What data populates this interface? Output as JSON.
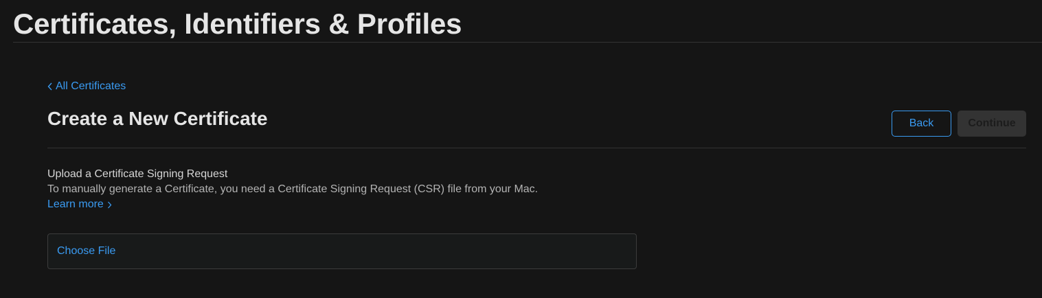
{
  "header": {
    "title": "Certificates, Identifiers & Profiles"
  },
  "nav": {
    "back_link_label": "All Certificates"
  },
  "section": {
    "title": "Create a New Certificate",
    "back_button_label": "Back",
    "continue_button_label": "Continue"
  },
  "upload": {
    "heading": "Upload a Certificate Signing Request",
    "description": "To manually generate a Certificate, you need a Certificate Signing Request (CSR) file from your Mac.",
    "learn_more_label": "Learn more",
    "choose_file_label": "Choose File"
  },
  "icons": {
    "back_chevron": "chevron-left-icon",
    "learn_more_chevron": "chevron-right-icon"
  },
  "colors": {
    "background": "#151515",
    "accent": "#3a9bf2",
    "heading_text": "#e5e5e5",
    "divider": "#333333",
    "disabled_button": "#333333"
  }
}
